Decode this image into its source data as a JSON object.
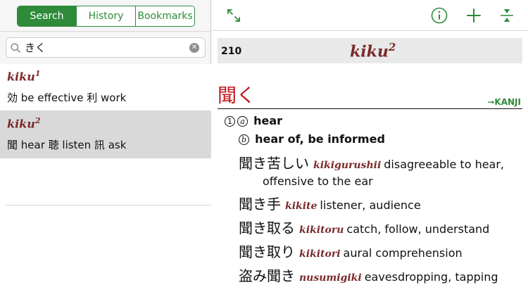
{
  "tabs": {
    "search": "Search",
    "history": "History",
    "bookmarks": "Bookmarks",
    "active": "Search"
  },
  "search": {
    "value": "きく"
  },
  "results": [
    {
      "head": "kiku",
      "sup": "1",
      "gloss": "効 be effective 利 work"
    },
    {
      "head": "kiku",
      "sup": "2",
      "gloss": "聞 hear 聴 listen 訊 ask"
    }
  ],
  "toolbar": {
    "icons": [
      "expand-icon",
      "info-icon",
      "plus-icon",
      "collapse-icon"
    ]
  },
  "entry": {
    "number": "210",
    "title": "kiku",
    "title_sup": "2",
    "kanji": "聞く",
    "kanji_link": "➞KANJI",
    "senses": [
      {
        "num": "①",
        "letter": "ⓐ",
        "text": "hear"
      },
      {
        "letter": "ⓑ",
        "text": "hear of, be informed"
      }
    ],
    "compounds": [
      {
        "jp": "聞き苦しい",
        "rom": "kikigurushii",
        "eng": "disagreeable to hear,",
        "eng2": "offensive to the ear"
      },
      {
        "jp": "聞き手",
        "rom": "kikite",
        "eng": "listener, audience"
      },
      {
        "jp": "聞き取る",
        "rom": "kikitoru",
        "eng": "catch, follow, understand"
      },
      {
        "jp": "聞き取り",
        "rom": "kikitori",
        "eng": "aural comprehension"
      },
      {
        "jp": "盗み聞き",
        "rom": "nusumigiki",
        "eng": "eavesdropping, tapping"
      }
    ]
  },
  "colors": {
    "accent": "#2e8b3a",
    "headword": "#7a2a2a",
    "kanji": "#c0141c"
  }
}
